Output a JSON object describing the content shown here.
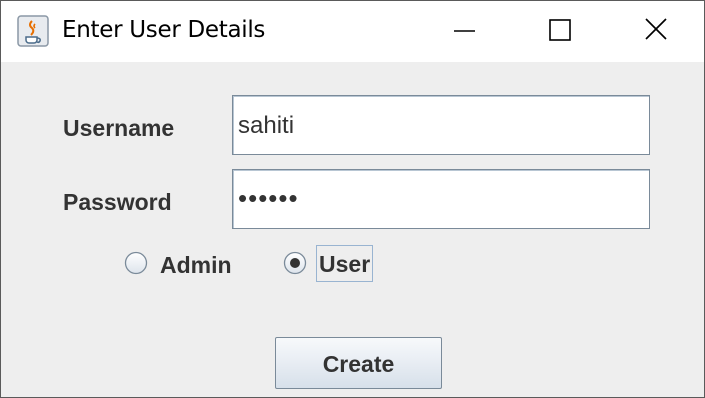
{
  "window": {
    "title": "Enter User Details",
    "icon": "java-cup-icon"
  },
  "form": {
    "username_label": "Username",
    "username_value": "sahiti",
    "password_label": "Password",
    "password_masked": "••••••",
    "roles": [
      {
        "label": "Admin",
        "selected": false
      },
      {
        "label": "User",
        "selected": true
      }
    ]
  },
  "actions": {
    "create_label": "Create"
  },
  "colors": {
    "window_bg": "#eeeeee",
    "titlebar_bg": "#ffffff",
    "text": "#333333",
    "field_border": "#7a8a99",
    "focus_border": "#99b4d1"
  }
}
